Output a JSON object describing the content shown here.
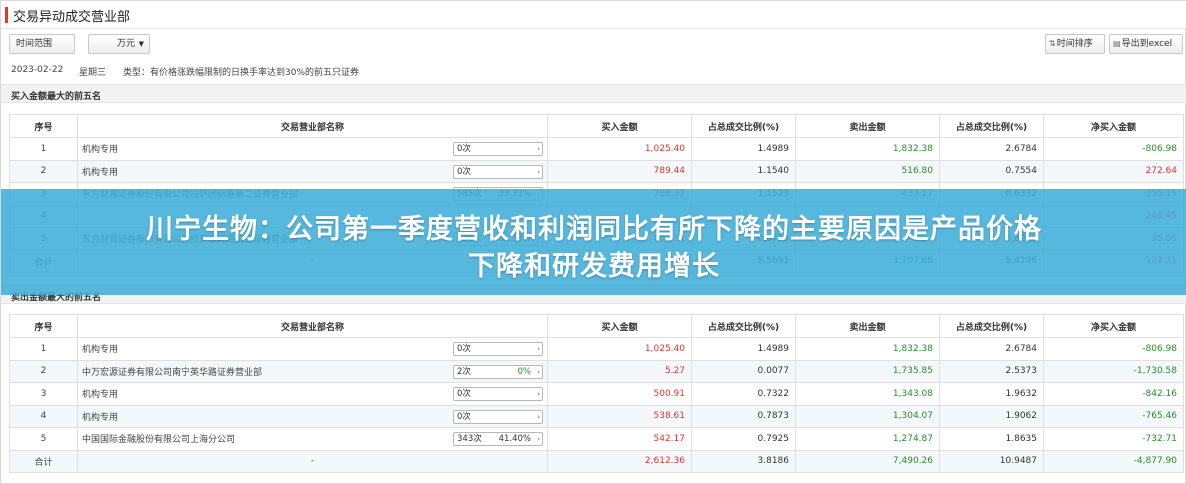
{
  "window": {
    "title": "交易异动成交营业部",
    "accent_color": "#e0342c"
  },
  "toolbar": {
    "range_label": "时间范围",
    "unit_value": "万元",
    "sort_label": "时间排序",
    "export_label": "导出到excel"
  },
  "info": {
    "date": "2023-02-22",
    "weekday": "星期三",
    "type_text": "类型：有价格涨跌幅限制的日换手率达到30%的前五只证券"
  },
  "columns": [
    "序号",
    "交易营业部名称",
    "买入金额",
    "占总成交比例(%)",
    "卖出金额",
    "占总成交比例(%)",
    "净买入金额"
  ],
  "buy_section": {
    "title": "买入金额最大的前五名",
    "rows": [
      {
        "no": "1",
        "name": "机构专用",
        "count": "0次",
        "pct": "",
        "buy": "1,025.40",
        "buy_ratio": "1.4989",
        "sell": "1,832.38",
        "sell_ratio": "2.6784",
        "net": "-806.98"
      },
      {
        "no": "2",
        "name": "机构专用",
        "count": "0次",
        "pct": "",
        "buy": "789.44",
        "buy_ratio": "1.1540",
        "sell": "516.80",
        "sell_ratio": "0.7554",
        "net": "272.64"
      },
      {
        "no": "3",
        "name": "东方财富证券股份有限公司拉萨团结路第二证券营业部",
        "count": "585次",
        "pct": "33.33%",
        "buy": "788.32",
        "buy_ratio": "1.1523",
        "sell": "433.17",
        "sell_ratio": "0.6332",
        "net": "355.15"
      },
      {
        "no": "4",
        "name": "",
        "count": "",
        "pct": "",
        "buy": "",
        "buy_ratio": "",
        "sell": "",
        "sell_ratio": "",
        "net": "246.45"
      },
      {
        "no": "5",
        "name": "东方财富证券股份有限公司拉萨东环路第二证券营业部",
        "count": "636次",
        "pct": "33.33%",
        "buy": "601.31",
        "buy_ratio": "0.8793",
        "sell": "",
        "sell_ratio": "0.8280",
        "net": "35.06"
      }
    ],
    "total": {
      "label": "合计",
      "dash": "-",
      "buy": "",
      "buy_ratio": "5.5691",
      "sell": "3,707.66",
      "sell_ratio": "5.4196",
      "net": "102.31"
    }
  },
  "sell_section": {
    "title": "卖出金额最大的前五名",
    "rows": [
      {
        "no": "1",
        "name": "机构专用",
        "count": "0次",
        "pct": "",
        "buy": "1,025.40",
        "buy_ratio": "1.4989",
        "sell": "1,832.38",
        "sell_ratio": "2.6784",
        "net": "-806.98"
      },
      {
        "no": "2",
        "name": "中万宏源证券有限公司南宁英华路证券营业部",
        "count": "2次",
        "pct": "0%",
        "buy": "5.27",
        "buy_ratio": "0.0077",
        "sell": "1,735.85",
        "sell_ratio": "2.5373",
        "net": "-1,730.58"
      },
      {
        "no": "3",
        "name": "机构专用",
        "count": "0次",
        "pct": "",
        "buy": "500.91",
        "buy_ratio": "0.7322",
        "sell": "1,343.08",
        "sell_ratio": "1.9632",
        "net": "-842.16"
      },
      {
        "no": "4",
        "name": "机构专用",
        "count": "0次",
        "pct": "",
        "buy": "538.61",
        "buy_ratio": "0.7873",
        "sell": "1,304.07",
        "sell_ratio": "1.9062",
        "net": "-765.46"
      },
      {
        "no": "5",
        "name": "中国国际金融股份有限公司上海分公司",
        "count": "343次",
        "pct": "41.40%",
        "buy": "542.17",
        "buy_ratio": "0.7925",
        "sell": "1,274.87",
        "sell_ratio": "1.8635",
        "net": "-732.71"
      }
    ],
    "total": {
      "label": "合计",
      "dash": "-",
      "buy": "2,612.36",
      "buy_ratio": "3.8186",
      "sell": "7,490.26",
      "sell_ratio": "10.9487",
      "net": "-4,877.90"
    }
  },
  "banner": {
    "line1": "川宁生物：公司第一季度营收和利润同比有所下降的主要原因是产品价格",
    "line2": "下降和研发费用增长",
    "color": "#40aeda"
  }
}
